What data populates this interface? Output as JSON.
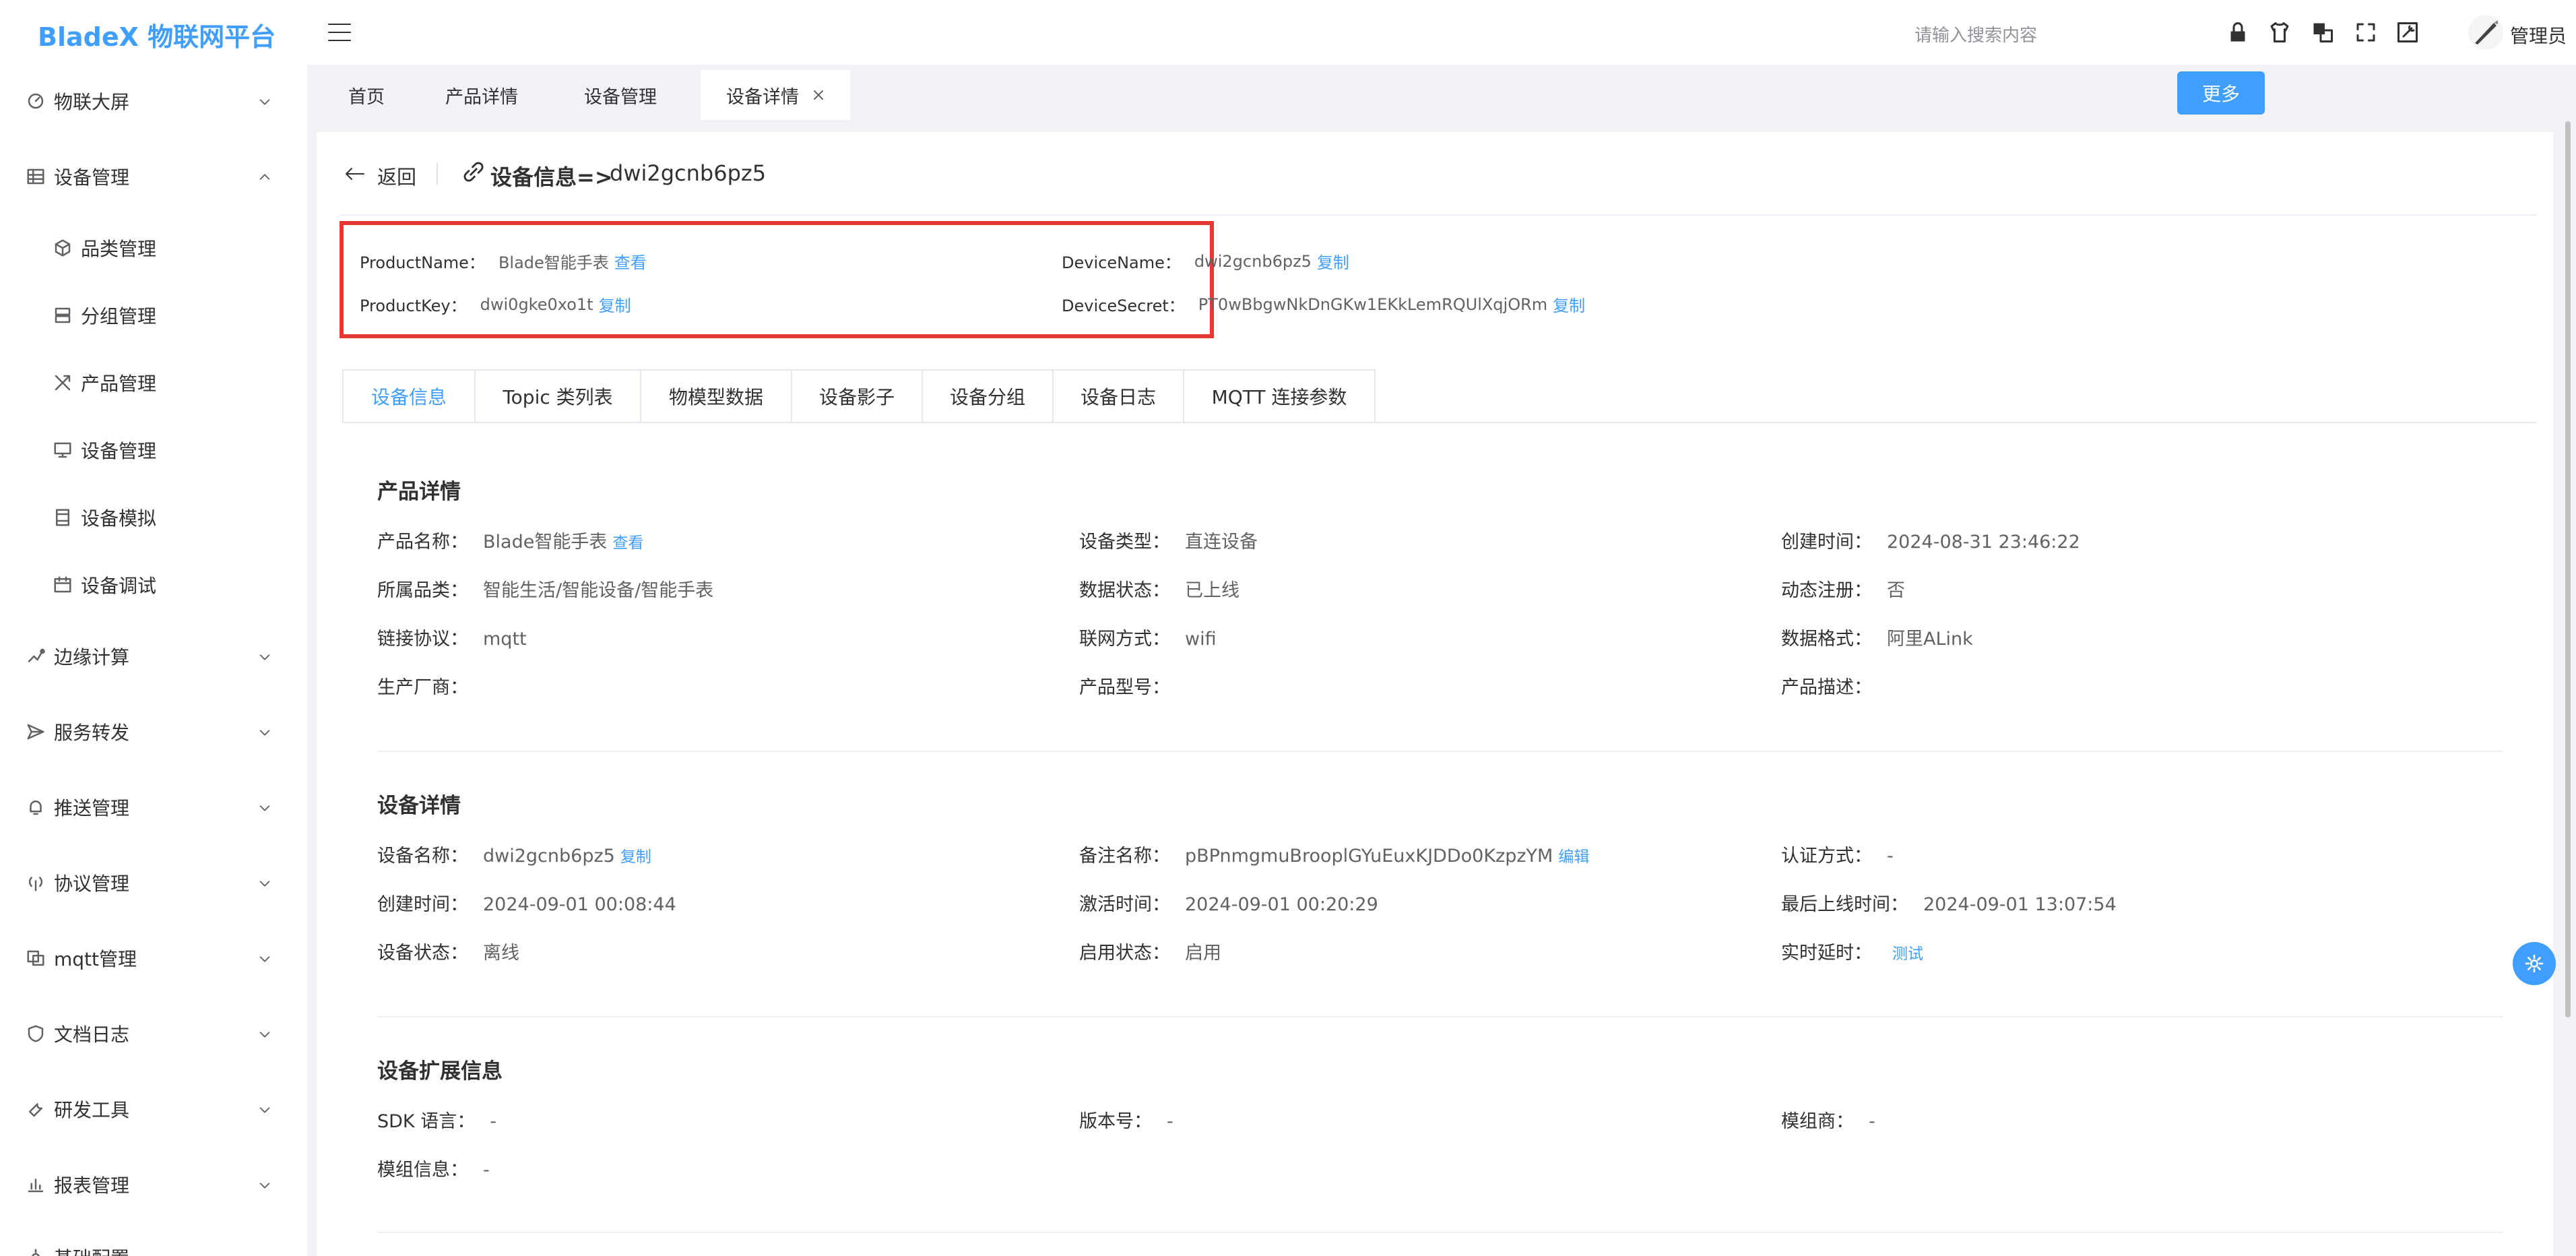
{
  "app": {
    "logo": "BladeX 物联网平台"
  },
  "topbar": {
    "search_placeholder": "请输入搜索内容",
    "user_name": "管理员"
  },
  "sidebar": {
    "items": [
      {
        "label": "物联大屏",
        "icon": "dashboard-icon",
        "expanded": false
      },
      {
        "label": "设备管理",
        "icon": "device-manage-icon",
        "expanded": true
      },
      {
        "label": "边缘计算",
        "icon": "edge-compute-icon",
        "expanded": false
      },
      {
        "label": "服务转发",
        "icon": "send-icon",
        "expanded": false
      },
      {
        "label": "推送管理",
        "icon": "bell-icon",
        "expanded": false
      },
      {
        "label": "协议管理",
        "icon": "antenna-icon",
        "expanded": false
      },
      {
        "label": "mqtt管理",
        "icon": "mqtt-icon",
        "expanded": false
      },
      {
        "label": "文档日志",
        "icon": "shield-icon",
        "expanded": false
      },
      {
        "label": "研发工具",
        "icon": "wrench-icon",
        "expanded": false
      },
      {
        "label": "报表管理",
        "icon": "bar-chart-icon",
        "expanded": false
      },
      {
        "label": "基础配置",
        "icon": "settings-icon",
        "expanded": false
      }
    ],
    "sub_items": [
      {
        "label": "品类管理",
        "icon": "cube-icon"
      },
      {
        "label": "分组管理",
        "icon": "group-icon"
      },
      {
        "label": "产品管理",
        "icon": "tools-icon"
      },
      {
        "label": "设备管理",
        "icon": "monitor-icon"
      },
      {
        "label": "设备模拟",
        "icon": "film-icon"
      },
      {
        "label": "设备调试",
        "icon": "calendar-icon"
      }
    ]
  },
  "page_tabs": [
    {
      "label": "首页",
      "active": false
    },
    {
      "label": "产品详情",
      "active": false
    },
    {
      "label": "设备管理",
      "active": false
    },
    {
      "label": "设备详情",
      "active": true,
      "closable": true
    }
  ],
  "more_button": "更多",
  "header": {
    "back": "返回",
    "title": "设备信息=>",
    "device": "dwi2gcnb6pz5"
  },
  "summary": {
    "product_name_label": "ProductName：",
    "product_name": "Blade智能手表",
    "product_name_link": "查看",
    "device_name_label": "DeviceName：",
    "device_name": "dwi2gcnb6pz5",
    "device_name_link": "复制",
    "product_key_label": "ProductKey：",
    "product_key": "dwi0gke0xo1t",
    "product_key_link": "复制",
    "device_secret_label": "DeviceSecret：",
    "device_secret": "PT0wBbgwNkDnGKw1EKkLemRQUlXqjORm",
    "device_secret_link": "复制"
  },
  "inner_tabs": [
    {
      "label": "设备信息",
      "active": true
    },
    {
      "label": "Topic 类列表",
      "active": false
    },
    {
      "label": "物模型数据",
      "active": false
    },
    {
      "label": "设备影子",
      "active": false
    },
    {
      "label": "设备分组",
      "active": false
    },
    {
      "label": "设备日志",
      "active": false
    },
    {
      "label": "MQTT 连接参数",
      "active": false
    }
  ],
  "product_section": {
    "title": "产品详情",
    "fields": [
      {
        "label": "产品名称：",
        "value": "Blade智能手表",
        "link": "查看"
      },
      {
        "label": "设备类型：",
        "value": "直连设备"
      },
      {
        "label": "创建时间：",
        "value": "2024-08-31 23:46:22"
      },
      {
        "label": "所属品类：",
        "value": "智能生活/智能设备/智能手表"
      },
      {
        "label": "数据状态：",
        "value": "已上线"
      },
      {
        "label": "动态注册：",
        "value": "否"
      },
      {
        "label": "链接协议：",
        "value": "mqtt"
      },
      {
        "label": "联网方式：",
        "value": "wifi"
      },
      {
        "label": "数据格式：",
        "value": "阿里ALink"
      },
      {
        "label": "生产厂商：",
        "value": ""
      },
      {
        "label": "产品型号：",
        "value": ""
      },
      {
        "label": "产品描述：",
        "value": ""
      }
    ]
  },
  "device_section": {
    "title": "设备详情",
    "fields": [
      {
        "label": "设备名称：",
        "value": "dwi2gcnb6pz5",
        "link": "复制"
      },
      {
        "label": "备注名称：",
        "value": "pBPnmgmuBrooplGYuEuxKJDDo0KzpzYM",
        "link": "编辑"
      },
      {
        "label": "认证方式：",
        "value": "-"
      },
      {
        "label": "创建时间：",
        "value": "2024-09-01 00:08:44"
      },
      {
        "label": "激活时间：",
        "value": "2024-09-01 00:20:29"
      },
      {
        "label": "最后上线时间：",
        "value": "2024-09-01 13:07:54"
      },
      {
        "label": "设备状态：",
        "value": "离线"
      },
      {
        "label": "启用状态：",
        "value": "启用"
      },
      {
        "label": "实时延时：",
        "value": "",
        "link": "测试"
      }
    ]
  },
  "ext_section": {
    "title": "设备扩展信息",
    "fields": [
      {
        "label": "SDK 语言：",
        "value": "-"
      },
      {
        "label": "版本号：",
        "value": "-"
      },
      {
        "label": "模组商：",
        "value": "-"
      },
      {
        "label": "模组信息：",
        "value": "-"
      }
    ]
  },
  "colors": {
    "primary": "#409eff",
    "highlight_border": "#e53935",
    "text": "#303133",
    "muted": "#606266"
  }
}
